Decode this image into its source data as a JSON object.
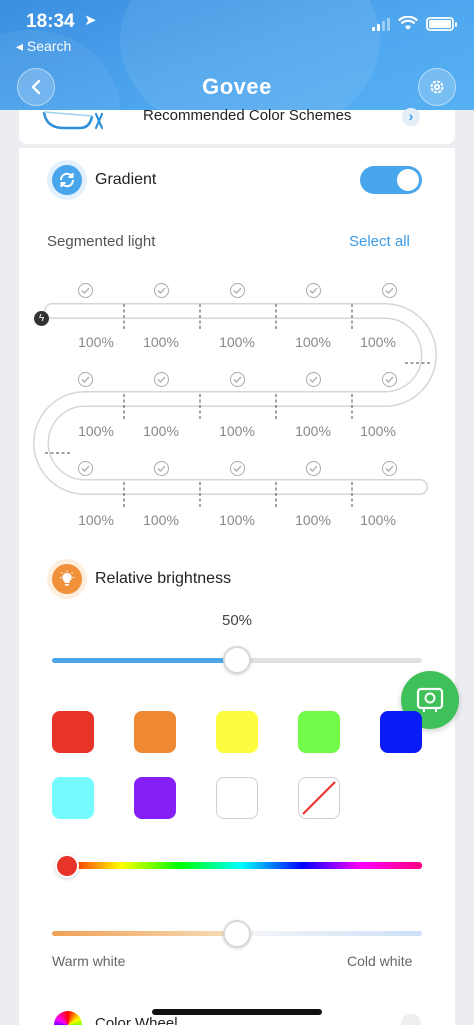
{
  "status_bar": {
    "time": "18:34",
    "back_app": "◂ Search"
  },
  "header": {
    "brand": "Govee",
    "back_icon": "chevron-left-icon",
    "settings_icon": "gear-icon"
  },
  "recommended": {
    "label": "Recommended Color Schemes"
  },
  "gradient": {
    "label": "Gradient",
    "enabled": true,
    "icon": "gradient-cycle-icon"
  },
  "segmented": {
    "title": "Segmented light",
    "select_all": "Select all",
    "rows": [
      [
        "100%",
        "100%",
        "100%",
        "100%",
        "100%"
      ],
      [
        "100%",
        "100%",
        "100%",
        "100%",
        "100%"
      ],
      [
        "100%",
        "100%",
        "100%",
        "100%",
        "100%"
      ]
    ]
  },
  "brightness": {
    "label": "Relative brightness",
    "value_text": "50%",
    "value": 0.5,
    "icon": "bulb-icon"
  },
  "swatches": {
    "colors": [
      "#e8332a",
      "#ef8833",
      "#fdfd3f",
      "#72fb49",
      "#0a1cf5",
      "#74fbfd",
      "#8420f6",
      "#ffffff",
      "none"
    ]
  },
  "hue_slider": {
    "value": 0.0
  },
  "temperature": {
    "warm_label": "Warm white",
    "cold_label": "Cold white",
    "value": 0.5
  },
  "color_wheel": {
    "label": "Color Wheel"
  },
  "colors": {
    "accent": "#4aa6ec",
    "fab": "#3fc15a"
  }
}
